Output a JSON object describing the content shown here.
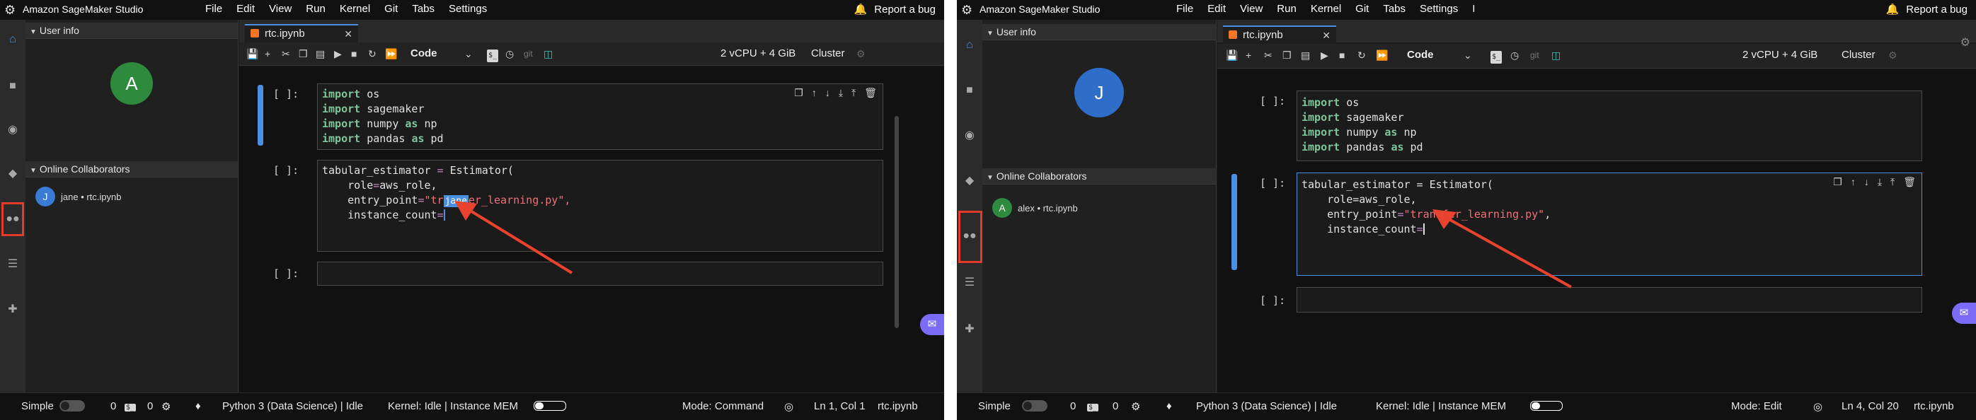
{
  "app": {
    "title": "Amazon SageMaker Studio",
    "menu": [
      "File",
      "Edit",
      "View",
      "Run",
      "Kernel",
      "Git",
      "Tabs",
      "Settings"
    ],
    "report_bug": "Report a bug"
  },
  "sidebar": {
    "user_info_header": "User info",
    "collaborators_header": "Online Collaborators"
  },
  "notebook": {
    "tab_title": "rtc.ipynb",
    "cell_type": "Code",
    "instance": "2 vCPU + 4 GiB",
    "cluster": "Cluster",
    "git_label": "git",
    "term_label": "$_",
    "prompt": "[ ]:",
    "cell1_lines": [
      "import os",
      "import sagemaker",
      "import numpy as np",
      "import pandas as pd"
    ],
    "cell2_lines": [
      "tabular_estimator = Estimator(",
      "    role=aws_role,",
      "    entry_point=\"transfer_learning.py\",",
      "    instance_count="
    ]
  },
  "left": {
    "avatar_letter": "A",
    "avatar_color": "#2e8b3d",
    "collaborator": {
      "initial": "J",
      "name": "jane • rtc.ipynb",
      "color": "#3a7bd5"
    },
    "cursor_user": "jane",
    "entry_point_before": "\"tr",
    "entry_point_after": "er_learning.py\",",
    "status": {
      "mode": "Simple",
      "count1": "0",
      "count2": "0",
      "kernel_name": "Python 3 (Data Science) | Idle",
      "kernel_state": "Kernel: Idle | Instance MEM",
      "mode_text": "Mode: Command",
      "position": "Ln 1, Col 1",
      "file": "rtc.ipynb"
    }
  },
  "right": {
    "extra_menu": "I",
    "avatar_letter": "J",
    "avatar_color": "#2f6ec8",
    "collaborator": {
      "initial": "A",
      "name": "alex • rtc.ipynb",
      "color": "#2e8b3d"
    },
    "status": {
      "mode": "Simple",
      "count1": "0",
      "count2": "0",
      "kernel_name": "Python 3 (Data Science) | Idle",
      "kernel_state": "Kernel: Idle | Instance MEM",
      "mode_text": "Mode: Edit",
      "position": "Ln 4, Col 20",
      "file": "rtc.ipynb"
    }
  },
  "colors": {
    "accent": "#4a90e2",
    "highlight": "#e23b2a",
    "keyword": "#7ec699",
    "string": "#f07178"
  }
}
